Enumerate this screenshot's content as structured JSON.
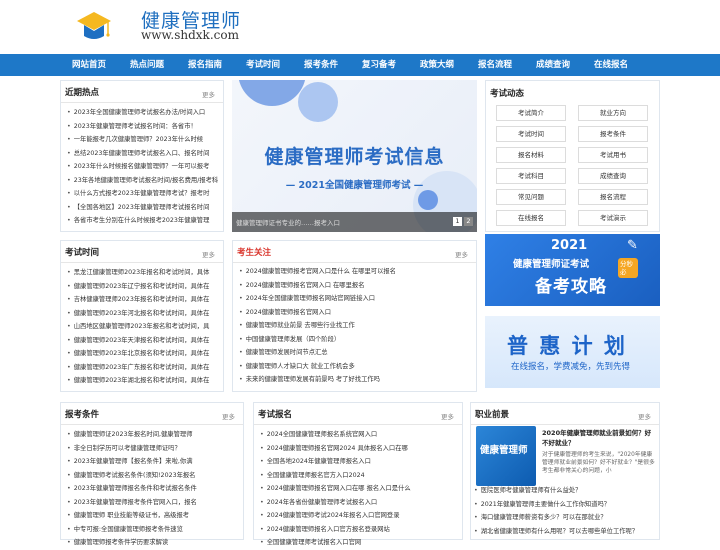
{
  "header": {
    "title": "健康管理师",
    "url": "www.shdxk.com"
  },
  "nav": [
    "网站首页",
    "热点问题",
    "报名指南",
    "考试时间",
    "报考条件",
    "复习备考",
    "政策大纲",
    "报名流程",
    "成绩查询",
    "在线报名"
  ],
  "common": {
    "more": "更多"
  },
  "recent": {
    "title": "近期热点",
    "items": [
      "2023年全国健康管理师考试报名办法/时间入口",
      "2023年健康管理师考试报名时间：各省市！",
      "一年能报考几次健康管理师？2023年什么时候",
      "总结2023年健康管理师考试报名入口、报名时间",
      "2023年什么时候报名健康管理师？一年可以报考",
      "23年各地健康管理师考试报名时间/报名费用/报考科",
      "以什么方式报考2023年健康管理师考试？报考时",
      "【全国各地区】2023年健康管理师考试报名时间",
      "各省市考生分别在什么时候报考2023年健康管理"
    ]
  },
  "exam_time": {
    "title": "考试时间",
    "items": [
      "黑龙江健康管理师2023年报名和考试时间，具体",
      "健康管理师2023年辽宁报名和考试时间，具体在",
      "吉林健康管理师2023年报名和考试时间，具体在",
      "健康管理师2023年河北报名和考试时间，具体在",
      "山西地区健康管理师2023年报名和考试时间，具",
      "健康管理师2023年天津报名和考试时间，具体在",
      "健康管理师2023年北京报名和考试时间，具体在",
      "健康管理师2023年广东报名和考试时间，具体在",
      "健康管理师2023年湖北报名和考试时间，具体在"
    ]
  },
  "banner": {
    "title": "健康管理师考试信息",
    "subtitle": "2021全国健康管理师考试",
    "caption": "健康管理师证书专业的……报考入口",
    "dots": [
      "1",
      "2"
    ]
  },
  "focus": {
    "title": "考生关注",
    "items": [
      "2024健康管理师报考官网入口是什么 在哪里可以报名",
      "2024健康管理师报名官网入口 在哪里报名",
      "2024年全国健康管理师报名网站官网链接入口",
      "2024健康管理师报名官网入口",
      "健康管理师就业前景 去哪些行业找工作",
      "中国健康管理师发展（四个阶段）",
      "健康管理师发展时间节点汇总",
      "健康管理师人才缺口大 就业工作机会多",
      "未来的健康管理师发展有前景吗 考了好找工作吗"
    ]
  },
  "dynamics": {
    "title": "考试动态",
    "buttons": [
      "考试简介",
      "就业方向",
      "考试时间",
      "报考条件",
      "报名材料",
      "考试用书",
      "考试科目",
      "成绩查询",
      "常见问题",
      "报名流程",
      "在线报名",
      "考试演示"
    ]
  },
  "promo1": {
    "year": "2021",
    "line1": "健康管理师证考试",
    "line2": "备考攻略",
    "tag": "分秒必"
  },
  "promo2": {
    "title": "普 惠 计 划",
    "sub": "在线报名，学费减免，先到先得"
  },
  "conditions": {
    "title": "报考条件",
    "items": [
      "健康管理师证2023年报名时间,健康管理师",
      "非全日制学历可以考健康管理师证吗？",
      "2023年健康管理师【报名条件】来啦,你满",
      "健康管理师考试报名条件(须知!2023年报名",
      "2023年健康管理师报名条件和考试报名条件",
      "2023年健康管理师报考条件官网入口，报名",
      "健康管理师 职业技能等级证书，高级报考",
      "中专可报:全国健康管理师报考条件速览",
      "健康管理师报考条件学历要求解读"
    ]
  },
  "registration": {
    "title": "考试报名",
    "items": [
      "2024全国健康管理师报名系统官网入口",
      "2024健康管理师报名官网2024 具体报名入口在哪",
      "全国各地2024年健康管理师报名入口",
      "全国健康管理师报名官方入口2024",
      "2024健康管理师报名官网入口在哪 报名入口是什么",
      "2024年各省份健康管理师考试报名入口",
      "2024健康管理师考试2024年报名入口官网登录",
      "2024健康管理师报名入口官方报名登录网站",
      "全国健康管理师考试报名入口官网"
    ]
  },
  "career": {
    "title": "职业前景",
    "img_label": "健康管理师",
    "feature_title": "2020年健康管理师就业前景如何？好不好就业？",
    "feature_text": "对于健康管理师的考生来说，\"2020年健康管理师就业前景如何？好不好就业？\"是很多考生都非常关心的问题，小",
    "items": [
      "医院医师考健康管理师有什么益处？",
      "2021年健康管理师主要做什么工作你知道吗？",
      "海口健康管理师薪资有多少？可以在那就业？",
      "湖北省健康管理师有什么用呢？可以去哪些单位工作呢？"
    ]
  }
}
